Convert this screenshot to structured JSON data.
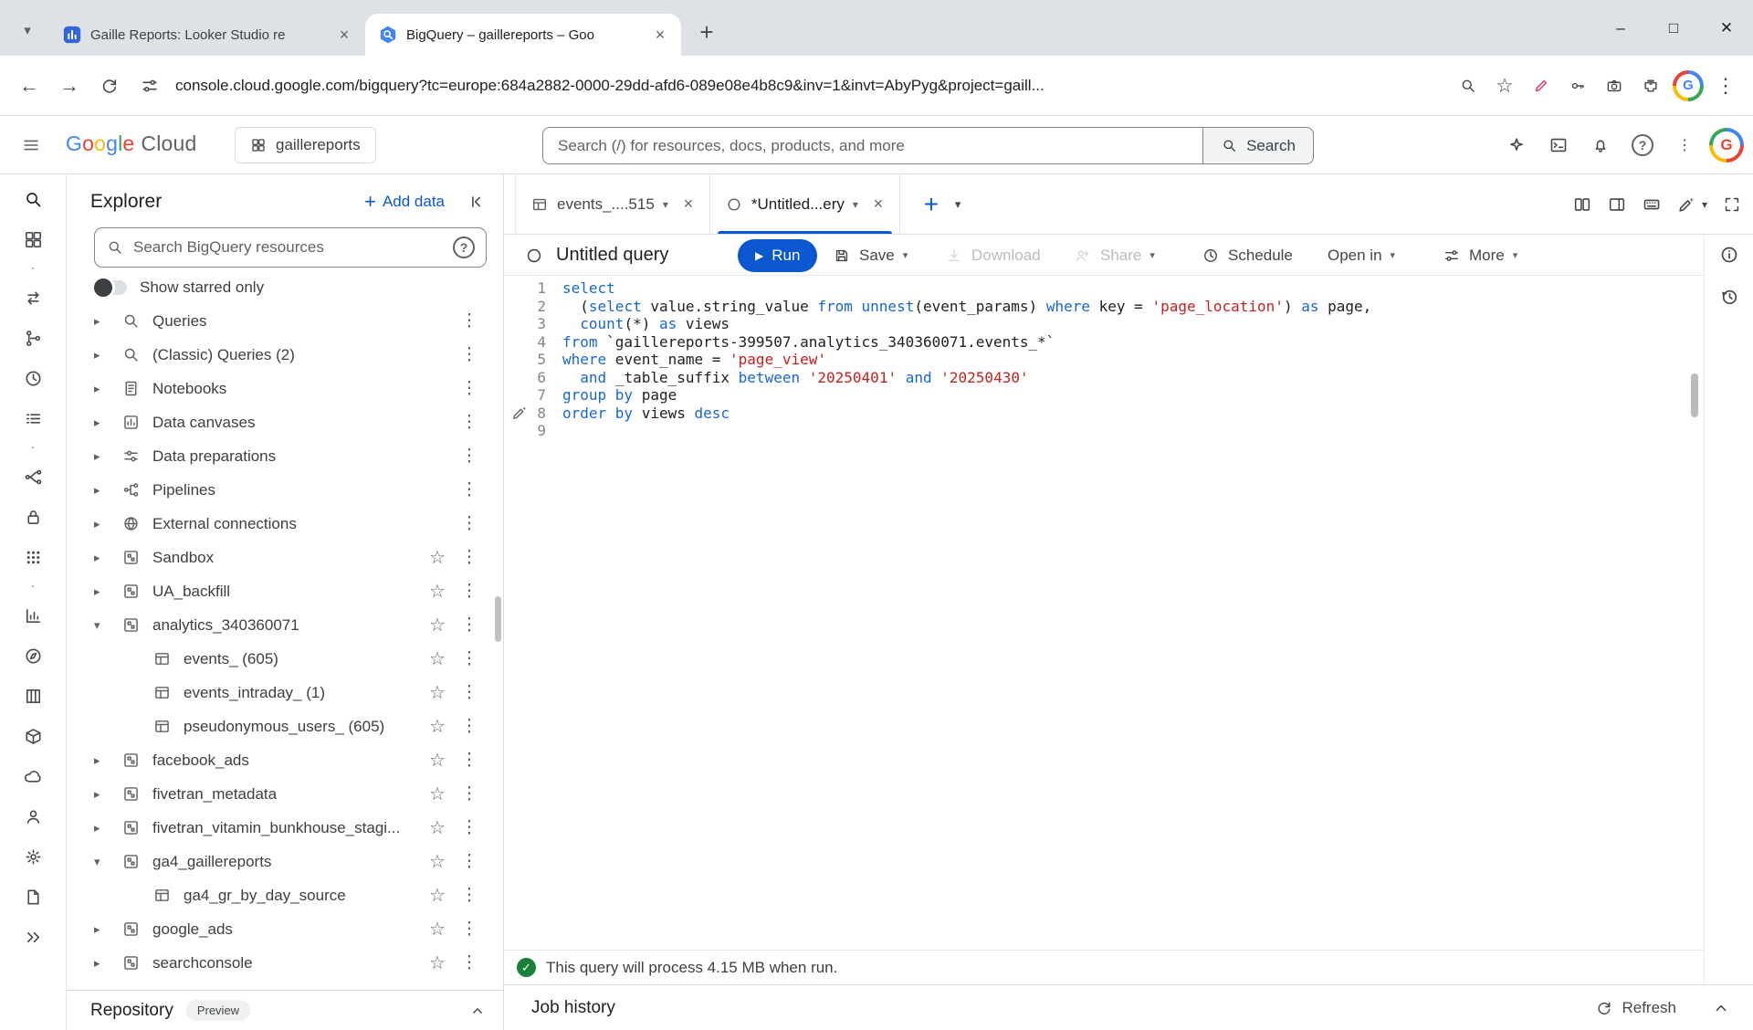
{
  "colors": {
    "accent": "#0b57d0",
    "keyword": "#1967d2",
    "string": "#c5221f",
    "success": "#188038"
  },
  "browser": {
    "tabs": [
      {
        "title": "Gaille Reports: Looker Studio re"
      },
      {
        "title": "BigQuery – gaillereports – Goo"
      }
    ],
    "url": "console.cloud.google.com/bigquery?tc=europe:684a2882-0000-29dd-afd6-089e08e4b8c9&inv=1&invt=AbyPyg&project=gaill..."
  },
  "header": {
    "brand_google": "Google",
    "brand_cloud": "Cloud",
    "project": "gaillereports",
    "search_placeholder": "Search (/) for resources, docs, products, and more",
    "search_button": "Search"
  },
  "rail": {
    "items": [
      "bigquery-pinned",
      "explorer",
      "divider-dot",
      "transfers",
      "scheduled-queries",
      "history",
      "queries-list",
      "divider-dot",
      "data-lineage",
      "governance",
      "apps",
      "divider-dot",
      "analytics-hub",
      "compass",
      "partitions",
      "sandbox",
      "cloud",
      "admin",
      "settings",
      "release-notes",
      "expand-rail"
    ]
  },
  "explorer": {
    "title": "Explorer",
    "add_data": "Add data",
    "search_placeholder": "Search BigQuery resources",
    "show_starred": "Show starred only",
    "repository": "Repository",
    "preview": "Preview",
    "items": [
      {
        "label": "Queries",
        "icon": "magnifier",
        "arrow": "right",
        "star": false,
        "level": 0
      },
      {
        "label": "(Classic) Queries (2)",
        "icon": "magnifier",
        "arrow": "right",
        "star": false,
        "level": 0
      },
      {
        "label": "Notebooks",
        "icon": "notebook",
        "arrow": "right",
        "star": false,
        "level": 0
      },
      {
        "label": "Data canvases",
        "icon": "canvas",
        "arrow": "right",
        "star": false,
        "level": 0
      },
      {
        "label": "Data preparations",
        "icon": "sliders",
        "arrow": "right",
        "star": false,
        "level": 0
      },
      {
        "label": "Pipelines",
        "icon": "pipeline",
        "arrow": "right",
        "star": false,
        "level": 0
      },
      {
        "label": "External connections",
        "icon": "globe",
        "arrow": "right",
        "star": false,
        "level": 0
      },
      {
        "label": "Sandbox",
        "icon": "dataset",
        "arrow": "right",
        "star": true,
        "level": 0
      },
      {
        "label": "UA_backfill",
        "icon": "dataset",
        "arrow": "right",
        "star": true,
        "level": 0
      },
      {
        "label": "analytics_340360071",
        "icon": "dataset",
        "arrow": "down",
        "star": true,
        "level": 0
      },
      {
        "label": "events_ (605)",
        "icon": "table",
        "arrow": "none",
        "star": true,
        "level": 1
      },
      {
        "label": "events_intraday_ (1)",
        "icon": "table",
        "arrow": "none",
        "star": true,
        "level": 1
      },
      {
        "label": "pseudonymous_users_ (605)",
        "icon": "table",
        "arrow": "none",
        "star": true,
        "level": 1
      },
      {
        "label": "facebook_ads",
        "icon": "dataset",
        "arrow": "right",
        "star": true,
        "level": 0
      },
      {
        "label": "fivetran_metadata",
        "icon": "dataset",
        "arrow": "right",
        "star": true,
        "level": 0
      },
      {
        "label": "fivetran_vitamin_bunkhouse_stagi...",
        "icon": "dataset",
        "arrow": "right",
        "star": true,
        "level": 0
      },
      {
        "label": "ga4_gaillereports",
        "icon": "dataset",
        "arrow": "down",
        "star": true,
        "level": 0
      },
      {
        "label": "ga4_gr_by_day_source",
        "icon": "table",
        "arrow": "none",
        "star": true,
        "level": 1
      },
      {
        "label": "google_ads",
        "icon": "dataset",
        "arrow": "right",
        "star": true,
        "level": 0
      },
      {
        "label": "searchconsole",
        "icon": "dataset",
        "arrow": "right",
        "star": true,
        "level": 0
      }
    ]
  },
  "editor": {
    "tabs": [
      {
        "title": "events_....515"
      },
      {
        "title": "*Untitled...ery"
      }
    ],
    "query_title": "Untitled query",
    "run": "Run",
    "save": "Save",
    "download": "Download",
    "share": "Share",
    "schedule": "Schedule",
    "open_in": "Open in",
    "more": "More",
    "status": "This query will process 4.15 MB when run.",
    "job_history": "Job history",
    "refresh": "Refresh",
    "code": [
      [
        [
          "k",
          "select"
        ]
      ],
      [
        [
          "t",
          "  ("
        ],
        [
          "k",
          "select"
        ],
        [
          "t",
          " value.string_value "
        ],
        [
          "k",
          "from"
        ],
        [
          "t",
          " "
        ],
        [
          "k",
          "unnest"
        ],
        [
          "t",
          "(event_params) "
        ],
        [
          "k",
          "where"
        ],
        [
          "t",
          " key = "
        ],
        [
          "s",
          "'page_location'"
        ],
        [
          "t",
          ") "
        ],
        [
          "k",
          "as"
        ],
        [
          "t",
          " page,"
        ]
      ],
      [
        [
          "t",
          "  "
        ],
        [
          "k",
          "count"
        ],
        [
          "t",
          "(*) "
        ],
        [
          "k",
          "as"
        ],
        [
          "t",
          " views"
        ]
      ],
      [
        [
          "k",
          "from"
        ],
        [
          "t",
          " `gaillereports-399507.analytics_340360071.events_*`"
        ]
      ],
      [
        [
          "k",
          "where"
        ],
        [
          "t",
          " event_name = "
        ],
        [
          "s",
          "'page_view'"
        ]
      ],
      [
        [
          "t",
          "  "
        ],
        [
          "k",
          "and"
        ],
        [
          "t",
          " _table_suffix "
        ],
        [
          "k",
          "between"
        ],
        [
          "t",
          " "
        ],
        [
          "s",
          "'20250401'"
        ],
        [
          "t",
          " "
        ],
        [
          "k",
          "and"
        ],
        [
          "t",
          " "
        ],
        [
          "s",
          "'20250430'"
        ]
      ],
      [
        [
          "k",
          "group by"
        ],
        [
          "t",
          " page"
        ]
      ],
      [
        [
          "k",
          "order by"
        ],
        [
          "t",
          " views "
        ],
        [
          "k",
          "desc"
        ]
      ],
      []
    ]
  }
}
